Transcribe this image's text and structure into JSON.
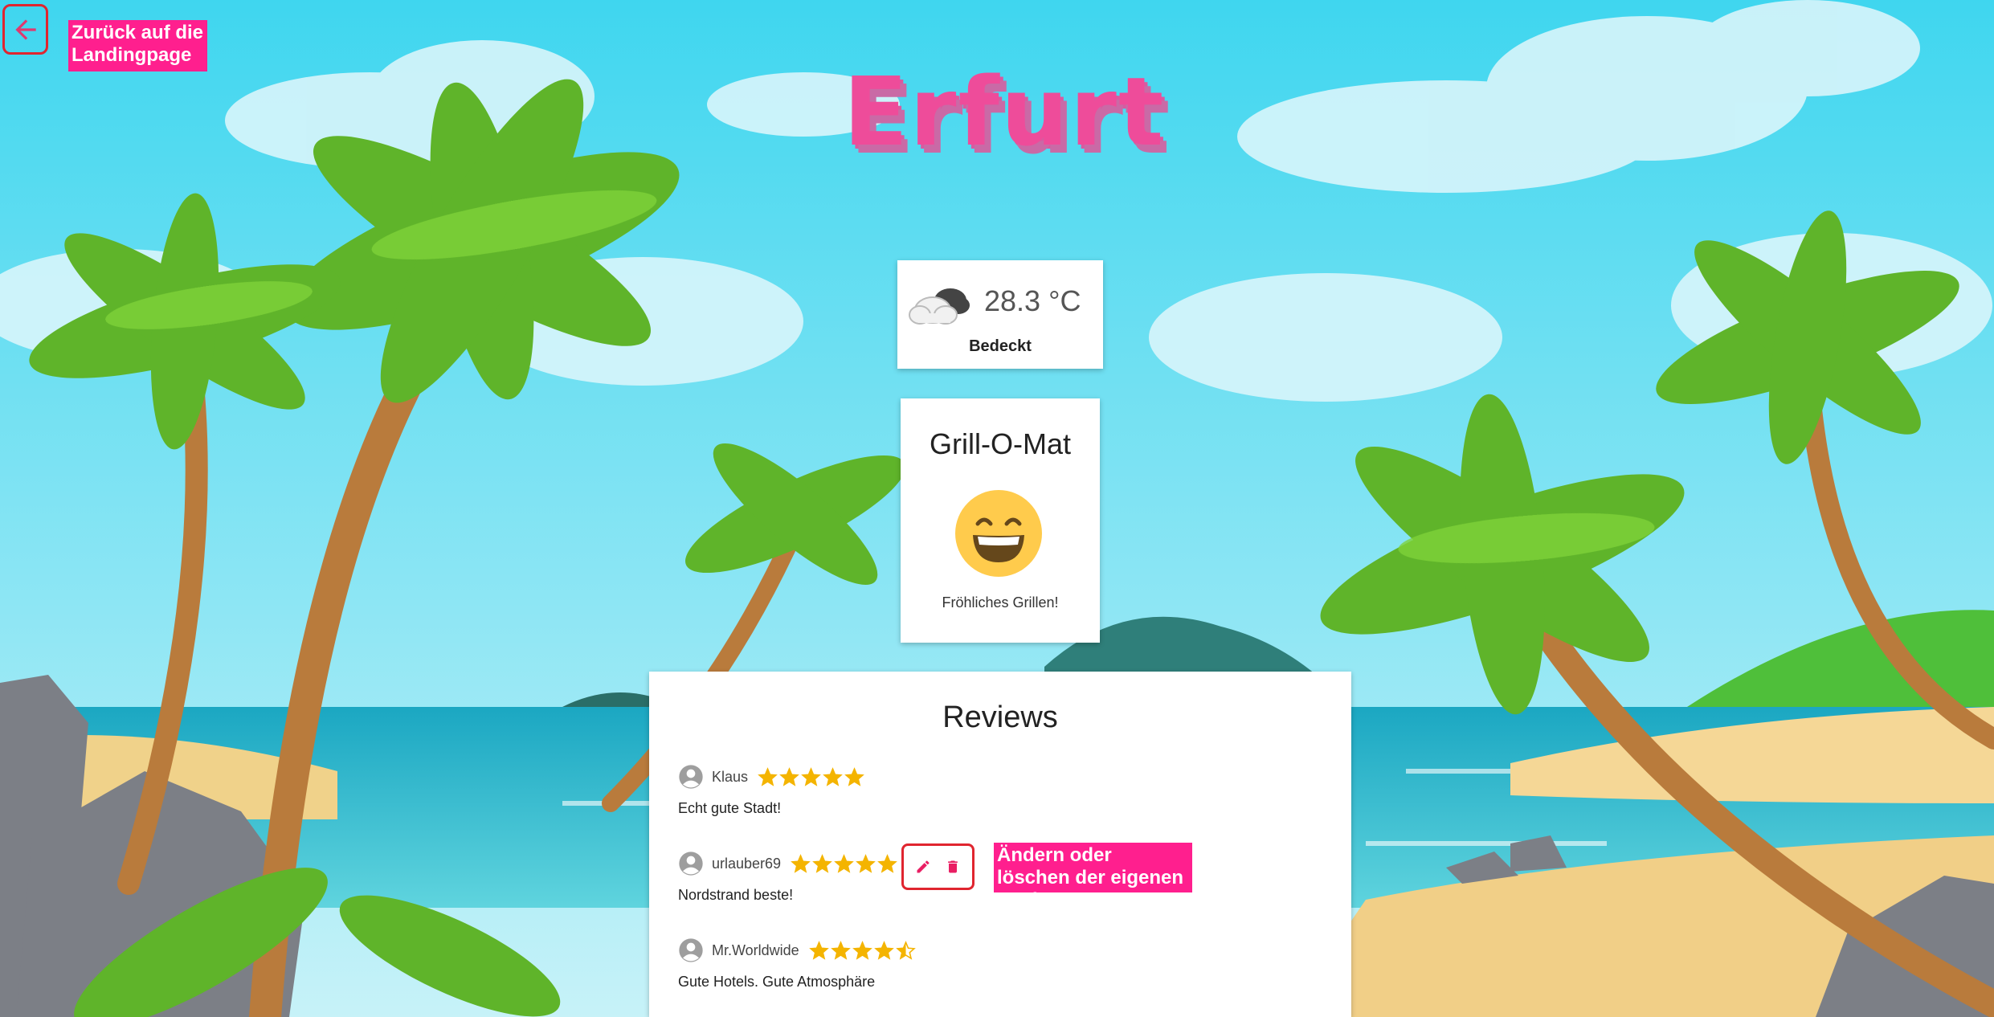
{
  "back": {
    "annotation": "Zurück auf die Landingpage"
  },
  "city": {
    "title": "Erfurt"
  },
  "weather": {
    "icon": "cloudy-icon",
    "temperature": "28.3 °C",
    "description": "Bedeckt"
  },
  "grill": {
    "title": "Grill-O-Mat",
    "icon": "grinning-face-icon",
    "description": "Fröhliches Grillen!"
  },
  "reviews": {
    "title": "Reviews",
    "items": [
      {
        "user": "Klaus",
        "rating": 5,
        "text": "Echt gute Stadt!"
      },
      {
        "user": "urlauber69",
        "rating": 5,
        "text": "Nordstrand beste!"
      },
      {
        "user": "Mr.Worldwide",
        "rating": 4.5,
        "text": "Gute Hotels. Gute Atmosphäre"
      }
    ]
  },
  "edit_annotation": "Ändern oder löschen der eigenen Review",
  "colors": {
    "accent_pink": "#ff1f8e",
    "highlight_red": "#e0252f",
    "star_gold": "#f4b400",
    "title_pink": "#ee4c9a"
  }
}
